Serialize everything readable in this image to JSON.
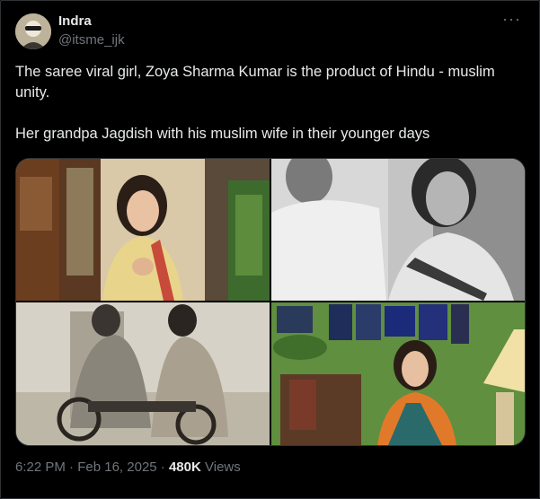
{
  "author": {
    "name": "Indra",
    "handle": "@itsme_ijk"
  },
  "more_icon": "more-horizontal-icon",
  "tweet": {
    "text": "The saree viral girl, Zoya Sharma Kumar is the product of Hindu - muslim unity.\n\nHer grandpa Jagdish with his muslim wife in their younger days"
  },
  "footer": {
    "time": "6:22 PM",
    "separator1": "·",
    "date": "Feb 16, 2025",
    "separator2": "·",
    "views_count": "480K",
    "views_label": "Views"
  },
  "colors": {
    "background": "#000000",
    "text": "#e7e9ea",
    "secondary": "#71767b",
    "border": "#2f3336"
  }
}
